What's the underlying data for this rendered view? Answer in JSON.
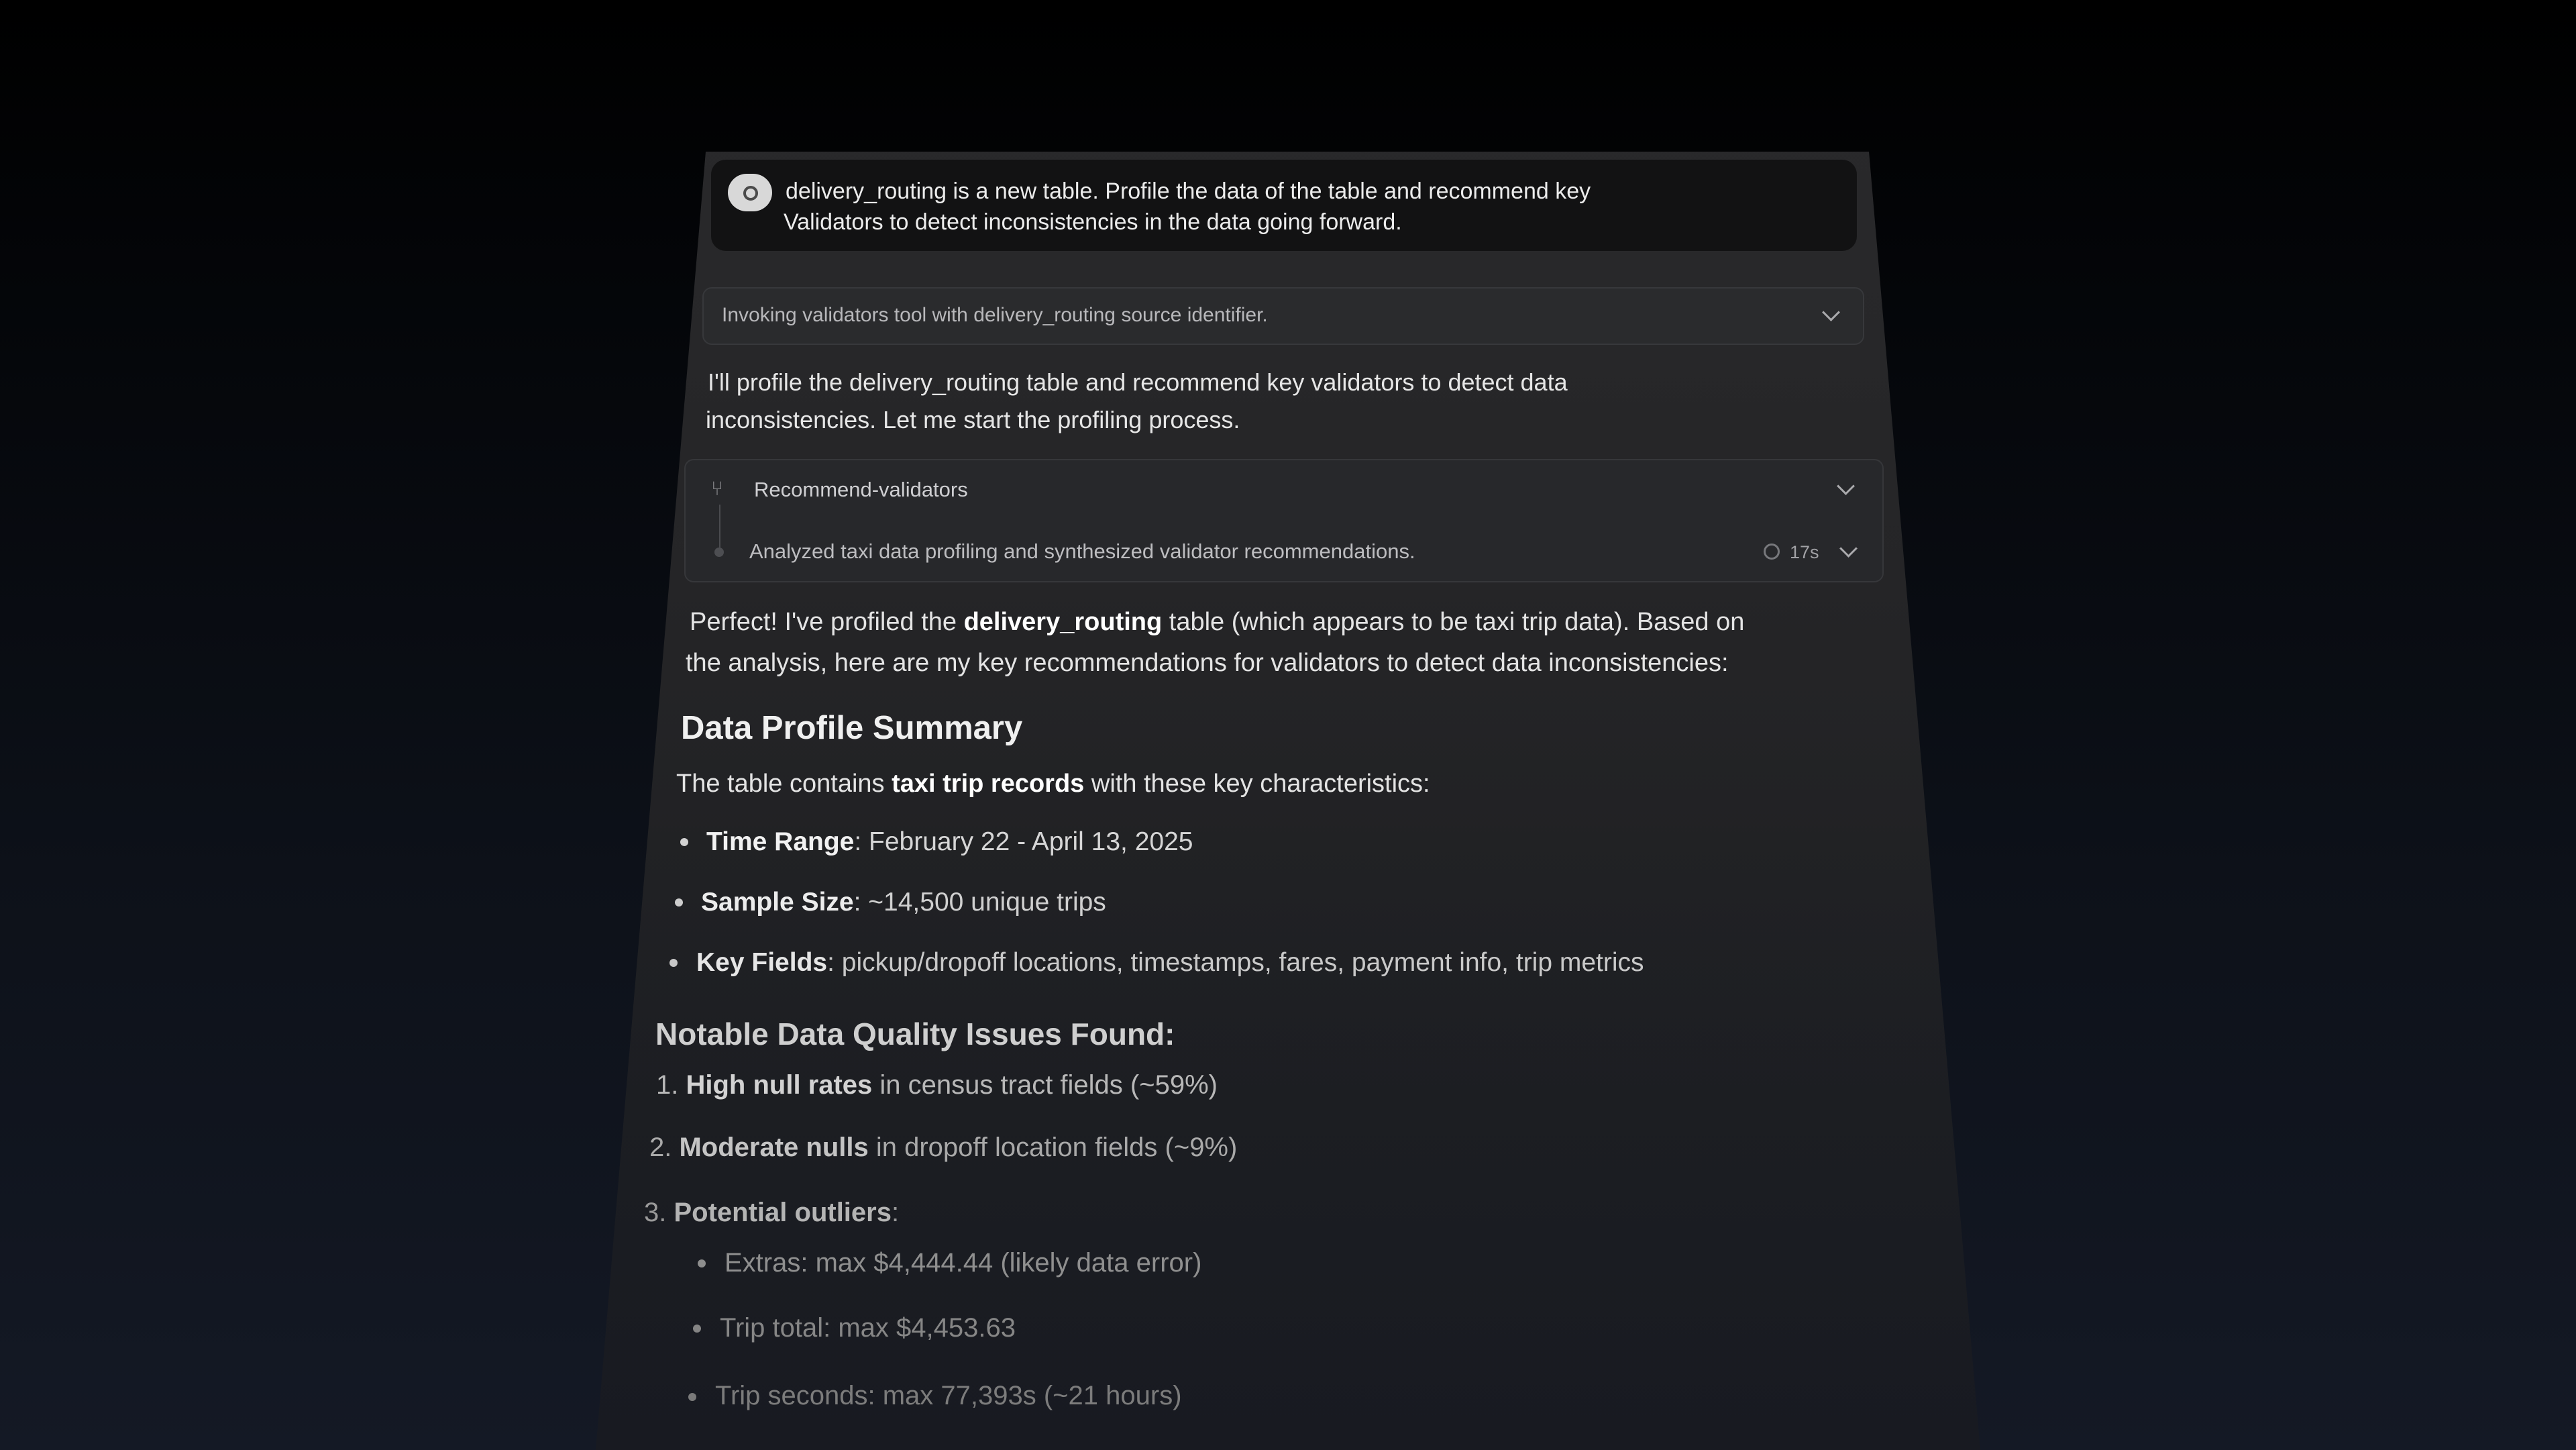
{
  "prompt": {
    "line1": "delivery_routing is a new table. Profile the data of the table and recommend key",
    "line2": "Validators to detect inconsistencies in the data going forward."
  },
  "tool_call": {
    "label": "Invoking validators tool with delivery_routing source identifier."
  },
  "intro": {
    "line1": "I'll profile the delivery_routing table and recommend key validators to detect data",
    "line2": "inconsistencies. Let me start the profiling process."
  },
  "validators_group": {
    "title": "Recommend-validators",
    "step": "Analyzed taxi data profiling and synthesized validator recommendations.",
    "duration": "17s"
  },
  "answer": {
    "line1_pre": "Perfect! I've profiled the ",
    "line1_bold": "delivery_routing",
    "line1_post": " table (which appears to be taxi trip data). Based on",
    "line2": "the analysis, here are my key recommendations for validators to detect data inconsistencies:"
  },
  "summary": {
    "heading": "Data Profile Summary",
    "intro_pre": "The table contains ",
    "intro_bold": "taxi trip records",
    "intro_post": " with these key characteristics:",
    "items": [
      {
        "label": "Time Range",
        "text": ": February 22 - April 13, 2025"
      },
      {
        "label": "Sample Size",
        "text": ": ~14,500 unique trips"
      },
      {
        "label": "Key Fields",
        "text": ": pickup/dropoff locations, timestamps, fares, payment info, trip metrics"
      }
    ]
  },
  "issues": {
    "heading": "Notable Data Quality Issues Found:",
    "items": [
      {
        "num": "1.",
        "label": "High null rates",
        "text": " in census tract fields (~59%)"
      },
      {
        "num": "2.",
        "label": "Moderate nulls",
        "text": " in dropoff location fields (~9%)"
      },
      {
        "num": "3.",
        "label": "Potential outliers",
        "text": ":"
      }
    ],
    "outliers": [
      "Extras: max $4,444.44 (likely data error)",
      "Trip total: max $4,453.63",
      "Trip seconds: max 77,393s (~21 hours)"
    ]
  }
}
